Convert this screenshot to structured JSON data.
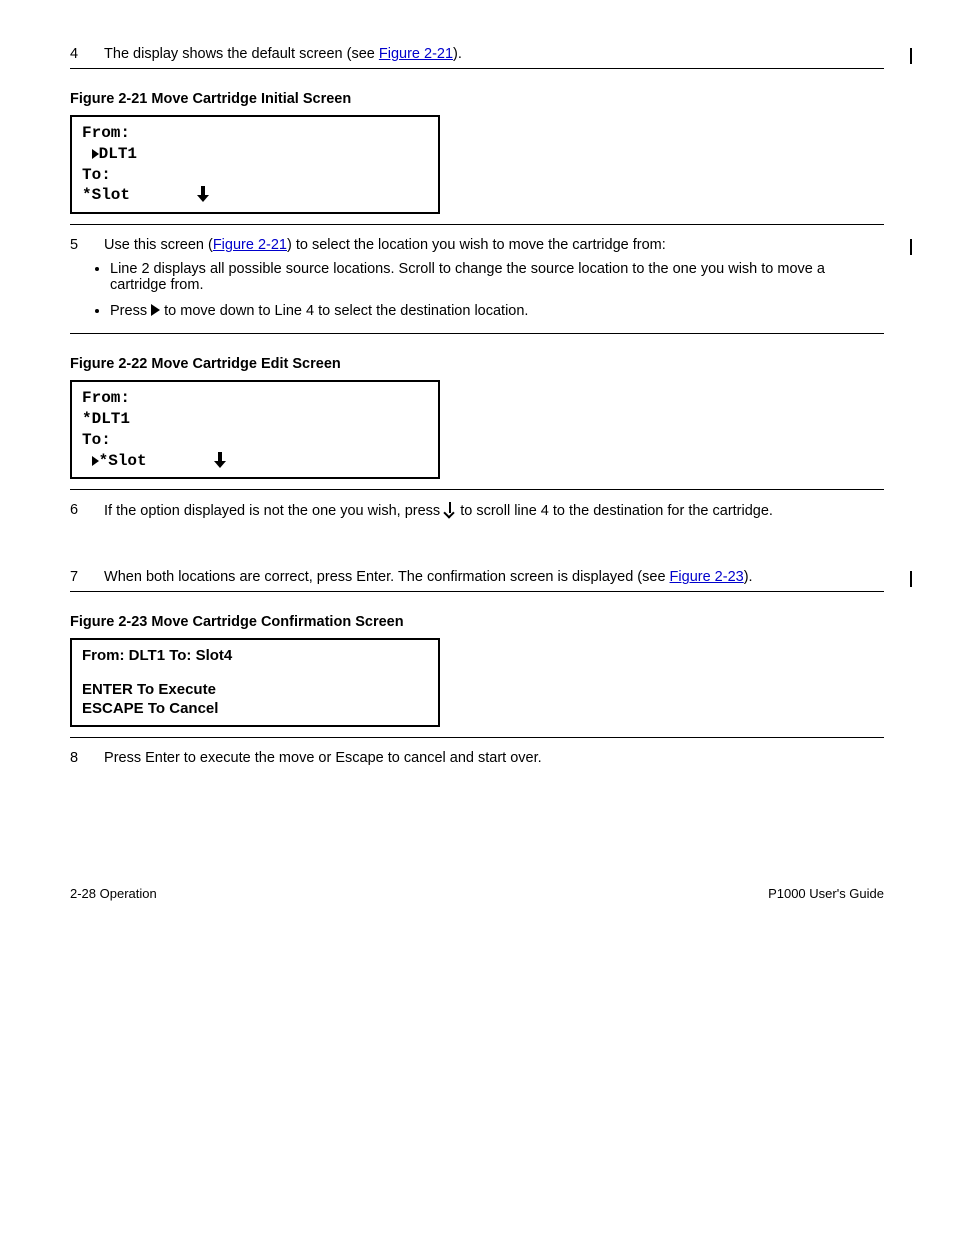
{
  "step4": {
    "num": "4",
    "text_a": "The display shows the default screen (see ",
    "link": "Figure 2-21",
    "text_b": ")."
  },
  "fig21": {
    "caption": "Figure 2-21  Move Cartridge Initial Screen",
    "line1": "From:",
    "line2_pre": "  ",
    "line2": "DLT1",
    "line3": "To:",
    "line4": "*Slot"
  },
  "step5": {
    "num": "5",
    "text_a": "Use this screen (",
    "link": "Figure 2-21",
    "text_b": ") to select the location you wish to move the cartridge from:",
    "bullet1": "Line 2 displays all possible source locations. Scroll to change the source location to the one you wish to move a cartridge from.",
    "bullet2_a": "Press ",
    "bullet2_b": " to move down to Line 4 to select the destination location."
  },
  "fig22": {
    "caption": "Figure 2-22  Move Cartridge Edit Screen",
    "line1": "From:",
    "line2": "*DLT1",
    "line3": "To:",
    "line4_pre": "  ",
    "line4": "*Slot"
  },
  "step6": {
    "num": "6",
    "text_a": "If the option displayed is not the one you wish, press ",
    "text_b": " to scroll line 4 to the destination for the cartridge."
  },
  "step7": {
    "num": "7",
    "text_a": "When both locations are correct, press Enter. The confirmation screen is displayed (see ",
    "link": "Figure 2-23",
    "text_b": ")."
  },
  "fig23": {
    "caption": "Figure 2-23  Move Cartridge Confirmation Screen",
    "line1": "From: DLT1 To: Slot4",
    "line2": "ENTER To Execute",
    "line3": "ESCAPE To Cancel"
  },
  "step8": {
    "num": "8",
    "text": "Press Enter to execute the move or Escape to cancel and start over."
  },
  "footer": {
    "left": "2-28 Operation",
    "right": "P1000 User's Guide"
  }
}
